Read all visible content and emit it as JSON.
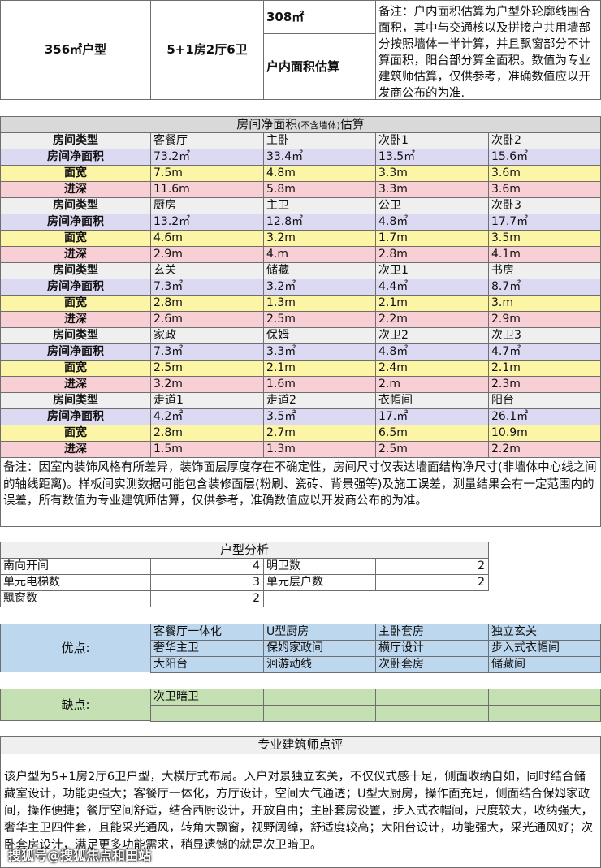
{
  "header": {
    "area_type": "356㎡户型",
    "layout": "5+1房2厅6卫",
    "area_value": "308㎡",
    "area_label": "户内面积估算",
    "note": "备注：户内面积估算为户型外轮廓线围合面积，其中与交通核以及拼接户共用墙部分按照墙体一半计算，并且飘窗部分不计算面积，阳台部分算全面积。数值为专业建筑师估算，仅供参考，准确数值应以开发商公布的为准."
  },
  "rooms": {
    "title_main": "房间净面积",
    "title_small": "(不含墙体)",
    "title_tail": "估算",
    "labels": {
      "type": "房间类型",
      "area": "房间净面积",
      "width": "面宽",
      "depth": "进深"
    },
    "groups": [
      {
        "rooms": [
          {
            "name": "客餐厅",
            "area": "73.2㎡",
            "width": "7.5m",
            "depth": "11.6m"
          },
          {
            "name": "主卧",
            "area": "33.4㎡",
            "width": "4.8m",
            "depth": "5.8m"
          },
          {
            "name": "次卧1",
            "area": "13.5㎡",
            "width": "3.3m",
            "depth": "3.3m"
          },
          {
            "name": "次卧2",
            "area": "15.6㎡",
            "width": "3.6m",
            "depth": "3.6m"
          }
        ]
      },
      {
        "rooms": [
          {
            "name": "厨房",
            "area": "13.2㎡",
            "width": "4.6m",
            "depth": "2.9m"
          },
          {
            "name": "主卫",
            "area": "12.8㎡",
            "width": "3.2m",
            "depth": "4.m"
          },
          {
            "name": "公卫",
            "area": "4.8㎡",
            "width": "1.7m",
            "depth": "2.8m"
          },
          {
            "name": "次卧3",
            "area": "17.7㎡",
            "width": "3.5m",
            "depth": "4.1m"
          }
        ]
      },
      {
        "rooms": [
          {
            "name": "玄关",
            "area": "7.3㎡",
            "width": "2.8m",
            "depth": "2.6m"
          },
          {
            "name": "储藏",
            "area": "3.2㎡",
            "width": "1.3m",
            "depth": "2.5m"
          },
          {
            "name": "次卫1",
            "area": "4.4㎡",
            "width": "2.1m",
            "depth": "2.2m"
          },
          {
            "name": "书房",
            "area": "8.7㎡",
            "width": "3.m",
            "depth": "2.9m"
          }
        ]
      },
      {
        "rooms": [
          {
            "name": "家政",
            "area": "7.3㎡",
            "width": "2.5m",
            "depth": "3.2m"
          },
          {
            "name": "保姆",
            "area": "3.3㎡",
            "width": "2.1m",
            "depth": "1.6m"
          },
          {
            "name": "次卫2",
            "area": "4.8㎡",
            "width": "2.4m",
            "depth": "2.m"
          },
          {
            "name": "次卫3",
            "area": "4.7㎡",
            "width": "2.1m",
            "depth": "2.3m"
          }
        ]
      },
      {
        "rooms": [
          {
            "name": "走道1",
            "area": "4.2㎡",
            "width": "2.8m",
            "depth": "1.5m"
          },
          {
            "name": "走道2",
            "area": "3.5㎡",
            "width": "2.7m",
            "depth": "1.3m"
          },
          {
            "name": "衣帽间",
            "area": "17.㎡",
            "width": "6.5m",
            "depth": "2.5m"
          },
          {
            "name": "阳台",
            "area": "26.1㎡",
            "width": "10.9m",
            "depth": "2.2m"
          }
        ]
      }
    ],
    "note": "备注：因室内装饰风格有所差异，装饰面层厚度存在不确定性，房间尺寸仅表达墙面结构净尺寸(非墙体中心线之间的轴线距离)。样板间实测数据可能包含装修面层(粉刷、瓷砖、背景强等)及施工误差，测量结果会有一定范围内的误差，所有数值为专业建筑师估算，仅供参考，准确数值应以开发商公布的为准。"
  },
  "analysis": {
    "title": "户型分析",
    "rows": [
      {
        "k1": "南向开间",
        "v1": "4",
        "k2": "明卫数",
        "v2": "2"
      },
      {
        "k1": "单元电梯数",
        "v1": "3",
        "k2": "单元层户数",
        "v2": "2"
      },
      {
        "k1": "飘窗数",
        "v1": "2"
      }
    ]
  },
  "pros": {
    "label": "优点:",
    "items": [
      [
        "客餐厅一体化",
        "U型厨房",
        "主卧套房",
        "独立玄关"
      ],
      [
        "奢华主卫",
        "保姆家政间",
        "横厅设计",
        "步入式衣帽间"
      ],
      [
        "大阳台",
        "洄游动线",
        "次卧套房",
        "储藏间"
      ]
    ]
  },
  "cons": {
    "label": "缺点:",
    "items": [
      [
        "次卫暗卫",
        "",
        "",
        ""
      ],
      [
        "",
        "",
        "",
        ""
      ]
    ]
  },
  "review": {
    "title": "专业建筑师点评",
    "text": "该户型为5+1房2厅6卫户型，大横厅式布局。入户对景独立玄关，不仅仪式感十足，侧面收纳自如，同时结合储藏室设计，功能更强大；客餐厅一体化，方厅设计，空间大气通透；U型大厨房，操作面充足，侧面结合保姆家政间，操作便捷；餐厅空间舒适，结合西厨设计，开放自由；主卧套房设置，步入式衣帽间，尺度较大，收纳强大，奢华主卫四件套，且能采光通风，转角大飘窗，视野阔绰，舒适度较高；大阳台设计，功能强大，采光通风好；次卧套房设计，满足更多功能需求，稍显遗憾的就是次卫暗卫。"
  },
  "watermark": "搜狐号@搜狐焦点和田站"
}
